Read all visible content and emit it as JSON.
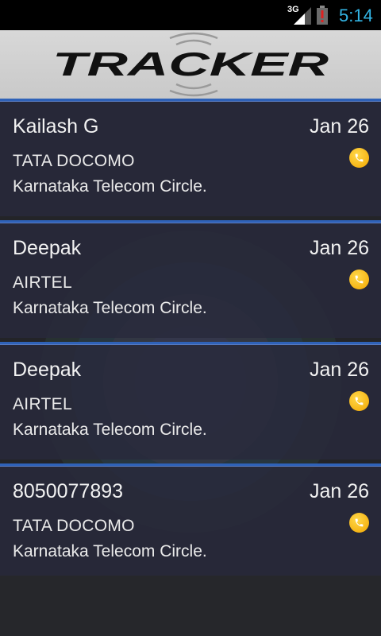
{
  "status_bar": {
    "network": "3G",
    "time": "5:14",
    "icons": [
      "signal-icon",
      "battery-alert-icon"
    ]
  },
  "header": {
    "logo_text": "TRACKER"
  },
  "calls": [
    {
      "name": "Kailash G",
      "date": "Jan 26",
      "carrier": "TATA DOCOMO",
      "circle": "Karnataka Telecom Circle.",
      "icon": "phone-icon"
    },
    {
      "name": "Deepak",
      "date": "Jan 26",
      "carrier": "AIRTEL",
      "circle": "Karnataka Telecom Circle.",
      "icon": "phone-icon"
    },
    {
      "name": "Deepak",
      "date": "Jan 26",
      "carrier": "AIRTEL",
      "circle": "Karnataka Telecom Circle.",
      "icon": "phone-icon"
    },
    {
      "name": "8050077893",
      "date": "Jan 26",
      "carrier": "TATA DOCOMO",
      "circle": "Karnataka Telecom Circle.",
      "icon": "phone-icon"
    }
  ],
  "colors": {
    "accent": "#33b5e5",
    "card_border": "#2f62b8",
    "call_icon": "#f2a600"
  }
}
